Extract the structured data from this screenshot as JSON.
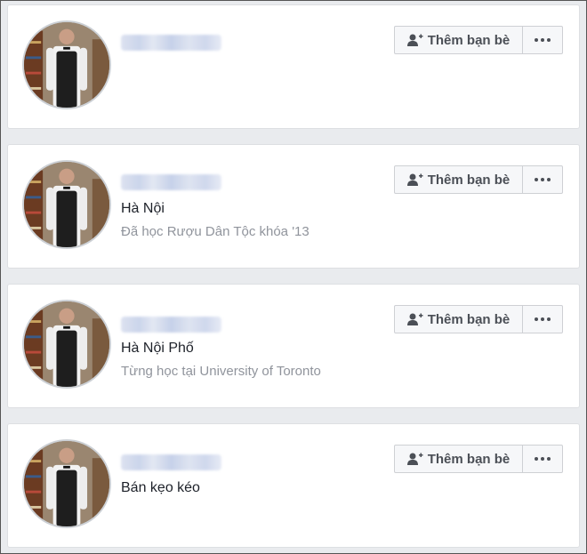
{
  "results": [
    {
      "line1": "",
      "line2": "",
      "add_friend_label": "Thêm bạn bè",
      "add_friend_icon": "add-friend-icon",
      "more_icon": "more-options-icon"
    },
    {
      "line1": "Hà Nội",
      "line2": "Đã học Rượu Dân Tộc khóa '13",
      "add_friend_label": "Thêm bạn bè",
      "add_friend_icon": "add-friend-icon",
      "more_icon": "more-options-icon"
    },
    {
      "line1": "Hà Nội Phố",
      "line2": "Từng học tại University of Toronto",
      "add_friend_label": "Thêm bạn bè",
      "add_friend_icon": "add-friend-icon",
      "more_icon": "more-options-icon"
    },
    {
      "line1": "Bán kẹo kéo",
      "line2": "",
      "add_friend_label": "Thêm bạn bè",
      "add_friend_icon": "add-friend-icon",
      "more_icon": "more-options-icon"
    }
  ],
  "colors": {
    "background": "#e9ebee",
    "card": "#ffffff",
    "primary_text": "#1d2129",
    "secondary_text": "#90949c",
    "button_text": "#4b4f56"
  }
}
